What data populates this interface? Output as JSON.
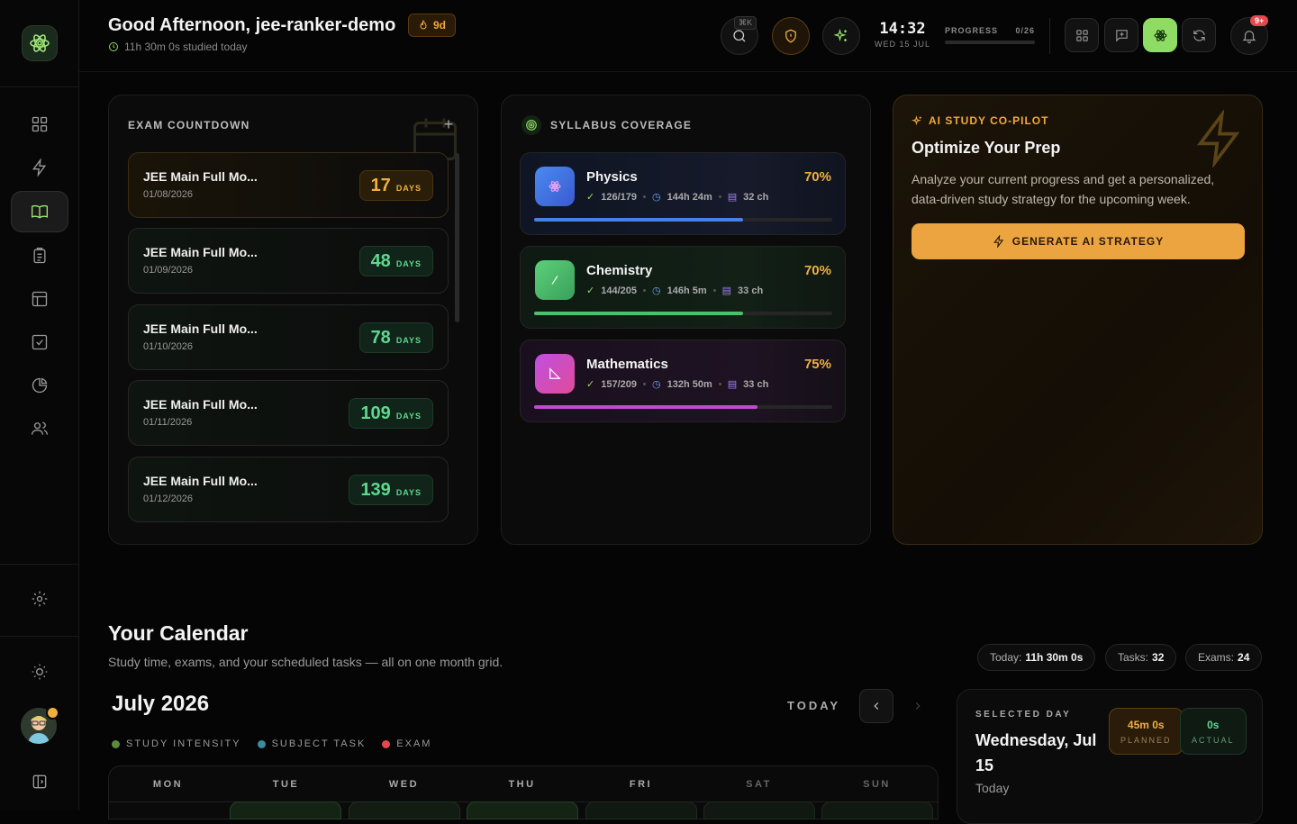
{
  "header": {
    "greeting": "Good Afternoon, jee-ranker-demo",
    "streak": "9d",
    "studied": "11h 30m 0s studied today",
    "kbd": "⌘K",
    "time": "14:32",
    "date": "WED 15 JUL",
    "progress_label": "PROGRESS",
    "progress_value": "0/26",
    "progress_fraction": 0,
    "notif_badge": "9+"
  },
  "exam_countdown": {
    "title": "EXAM COUNTDOWN",
    "unit": "DAYS",
    "exams": [
      {
        "name": "JEE Main Full Mo...",
        "date": "01/08/2026",
        "days": "17"
      },
      {
        "name": "JEE Main Full Mo...",
        "date": "01/09/2026",
        "days": "48"
      },
      {
        "name": "JEE Main Full Mo...",
        "date": "01/10/2026",
        "days": "78"
      },
      {
        "name": "JEE Main Full Mo...",
        "date": "01/11/2026",
        "days": "109"
      },
      {
        "name": "JEE Main Full Mo...",
        "date": "01/12/2026",
        "days": "139"
      }
    ]
  },
  "syllabus": {
    "title": "SYLLABUS COVERAGE",
    "subjects": [
      {
        "name": "Physics",
        "percent": "70%",
        "fraction": 0.7,
        "done": "126/179",
        "time": "144h 24m",
        "chapters": "32 ch",
        "color": "#4a7ee8"
      },
      {
        "name": "Chemistry",
        "percent": "70%",
        "fraction": 0.7,
        "done": "144/205",
        "time": "146h 5m",
        "chapters": "33 ch",
        "color": "#4cc06a"
      },
      {
        "name": "Mathematics",
        "percent": "75%",
        "fraction": 0.75,
        "done": "157/209",
        "time": "132h 50m",
        "chapters": "33 ch",
        "color": "#c04ad0"
      }
    ]
  },
  "ai": {
    "tag": "AI STUDY CO-PILOT",
    "heading": "Optimize Your Prep",
    "body": "Analyze your current progress and get a personalized, data-driven study strategy for the upcoming week.",
    "button": "GENERATE AI STRATEGY"
  },
  "calendar": {
    "title": "Your Calendar",
    "subtitle": "Study time, exams, and your scheduled tasks — all on one month grid.",
    "month": "July 2026",
    "today_btn": "TODAY",
    "legend": [
      "STUDY INTENSITY",
      "SUBJECT TASK",
      "EXAM"
    ],
    "legend_colors": [
      "#5a8a3a",
      "#3a8aa0",
      "#e5484d"
    ],
    "weekdays": [
      "MON",
      "TUE",
      "WED",
      "THU",
      "FRI",
      "SAT",
      "SUN"
    ],
    "stats": {
      "today_label": "Today:",
      "today_value": "11h 30m 0s",
      "tasks_label": "Tasks:",
      "tasks_value": "32",
      "exams_label": "Exams:",
      "exams_value": "24"
    },
    "selected": {
      "label": "SELECTED DAY",
      "day": "Wednesday, Jul 15",
      "sub": "Today",
      "planned_value": "45m 0s",
      "planned_label": "PLANNED",
      "actual_value": "0s",
      "actual_label": "ACTUAL"
    }
  }
}
